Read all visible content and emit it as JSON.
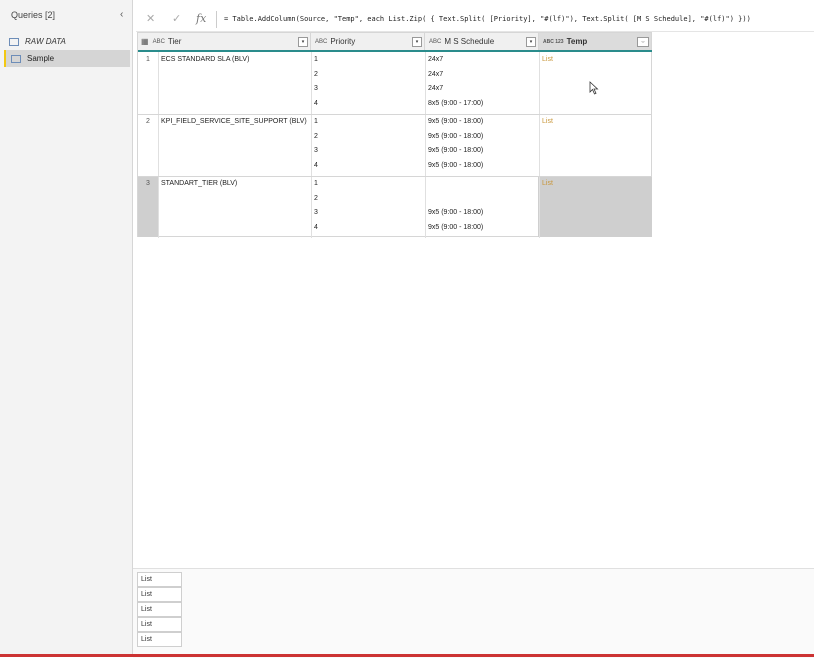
{
  "queries": {
    "title": "Queries [2]",
    "collapse_glyph": "‹",
    "items": [
      {
        "label": "RAW DATA",
        "selected": false
      },
      {
        "label": "Sample",
        "selected": true
      }
    ]
  },
  "formula": {
    "cancel_glyph": "✕",
    "commit_glyph": "✓",
    "fx_glyph": "fx",
    "text": "= Table.AddColumn(Source, \"Temp\", each List.Zip( { Text.Split( [Priority], \"#(lf)\"), Text.Split( [M S Schedule], \"#(lf)\") }))"
  },
  "grid": {
    "columns": [
      {
        "label": "Tier",
        "type": "ABC",
        "sel": "▦"
      },
      {
        "label": "Priority",
        "type": "ABC"
      },
      {
        "label": "M S Schedule",
        "type": "ABC"
      },
      {
        "label": "Temp",
        "type": "ABC 123"
      }
    ],
    "rows": [
      {
        "num": "1",
        "tier": "ECS STANDARD SLA (BLV)",
        "priority": [
          "1",
          "2",
          "3",
          "4"
        ],
        "schedule": [
          "24x7",
          "24x7",
          "24x7",
          "8x5 (9:00 - 17:00)"
        ],
        "temp": "List"
      },
      {
        "num": "2",
        "tier": "KPI_FIELD_SERVICE_SITE_SUPPORT (BLV)",
        "priority": [
          "1",
          "2",
          "3",
          "4"
        ],
        "schedule": [
          "9x5 (9:00 - 18:00)",
          "9x5 (9:00 - 18:00)",
          "9x5 (9:00 - 18:00)",
          "9x5 (9:00 - 18:00)"
        ],
        "temp": "List"
      },
      {
        "num": "3",
        "tier": "STANDART_TIER (BLV)",
        "priority": [
          "1",
          "2",
          "3",
          "4"
        ],
        "schedule": [
          "",
          "",
          "9x5 (9:00 - 18:00)",
          "9x5 (9:00 - 18:00)"
        ],
        "temp": "List"
      }
    ]
  },
  "preview": {
    "items": [
      "List",
      "List",
      "List",
      "List",
      "List"
    ]
  },
  "colors": {
    "accent_teal": "#2a8c8c",
    "list_link": "#c8963a",
    "selected_marker": "#f2c811"
  }
}
